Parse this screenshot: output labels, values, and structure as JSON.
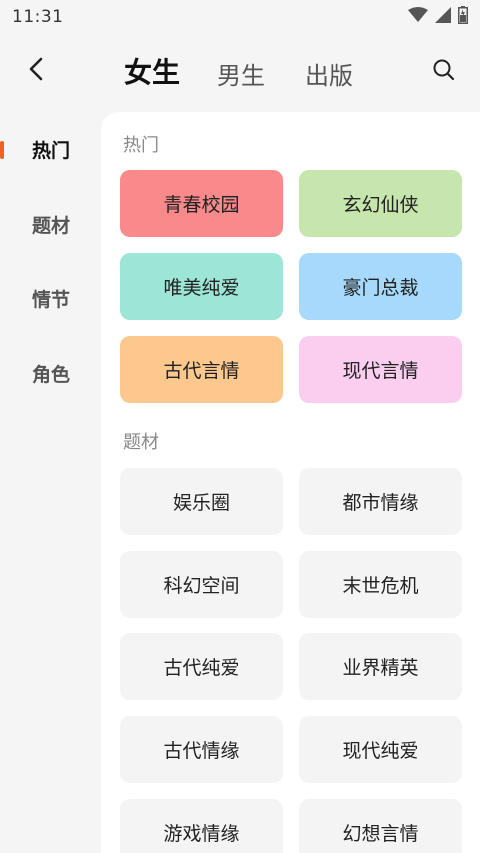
{
  "status_bar": {
    "time": "11:31",
    "icons": [
      "wifi-icon",
      "signal-icon",
      "battery-icon"
    ]
  },
  "header": {
    "back_icon": "chevron-left-icon",
    "tabs": [
      {
        "label": "女生",
        "active": true
      },
      {
        "label": "男生",
        "active": false
      },
      {
        "label": "出版",
        "active": false
      }
    ],
    "search_icon": "search-icon"
  },
  "side_nav": {
    "accent_color": "#f0631e",
    "items": [
      {
        "label": "热门",
        "active": true
      },
      {
        "label": "题材",
        "active": false
      },
      {
        "label": "情节",
        "active": false
      },
      {
        "label": "角色",
        "active": false
      }
    ]
  },
  "sections": {
    "hot": {
      "title": "热门",
      "items": [
        {
          "label": "青春校园",
          "color": "#f9898b"
        },
        {
          "label": "玄幻仙侠",
          "color": "#c6e6ad"
        },
        {
          "label": "唯美纯爱",
          "color": "#9ce5d7"
        },
        {
          "label": "豪门总裁",
          "color": "#a6d9fb"
        },
        {
          "label": "古代言情",
          "color": "#fdc88e"
        },
        {
          "label": "现代言情",
          "color": "#fbcdee"
        }
      ]
    },
    "genre": {
      "title": "题材",
      "items": [
        {
          "label": "娱乐圈"
        },
        {
          "label": "都市情缘"
        },
        {
          "label": "科幻空间"
        },
        {
          "label": "末世危机"
        },
        {
          "label": "古代纯爱"
        },
        {
          "label": "业界精英"
        },
        {
          "label": "古代情缘"
        },
        {
          "label": "现代纯爱"
        },
        {
          "label": "游戏情缘"
        },
        {
          "label": "幻想言情"
        }
      ]
    }
  }
}
